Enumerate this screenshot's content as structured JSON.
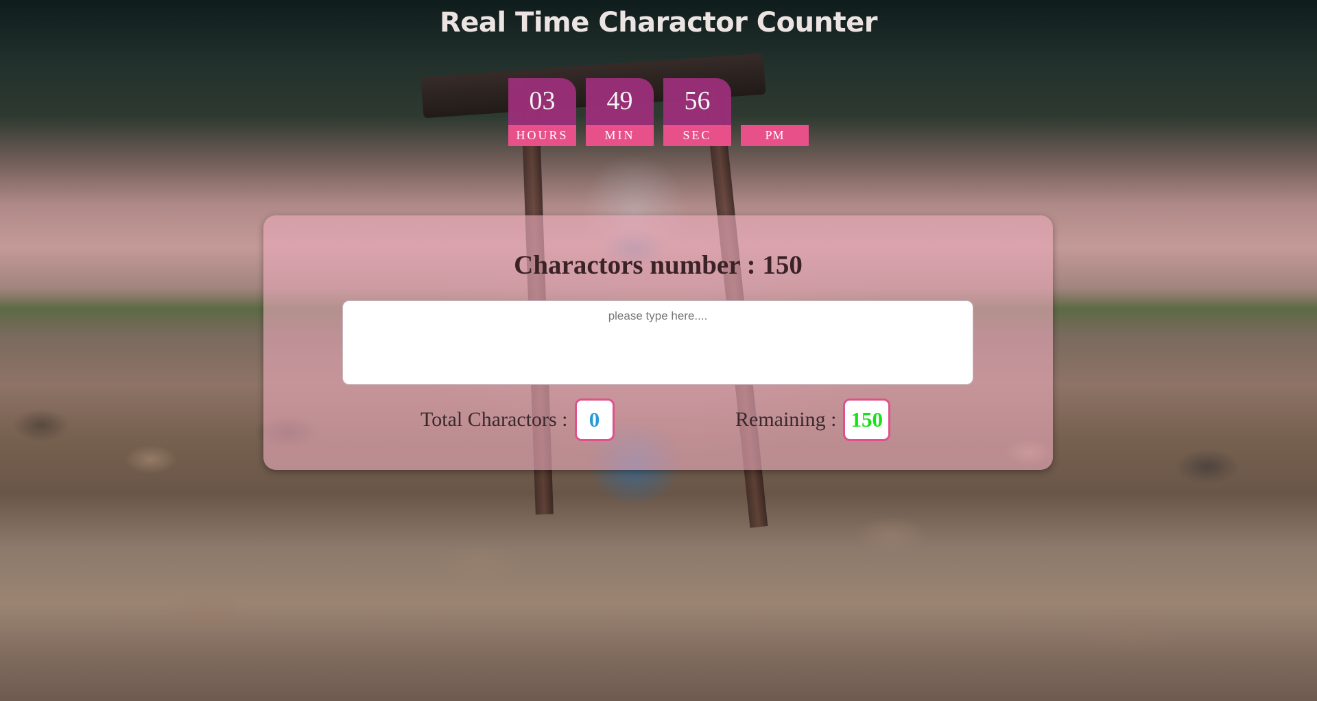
{
  "page": {
    "title": "Real Time Charactor Counter"
  },
  "clock": {
    "hours": "03",
    "hours_label": "HOURS",
    "minutes": "49",
    "minutes_label": "MIN",
    "seconds": "56",
    "seconds_label": "SEC",
    "ampm": "PM"
  },
  "counter": {
    "heading": "Charactors number : 150",
    "input": {
      "value": "",
      "placeholder": "please type here...."
    },
    "total_label": "Total Charactors :",
    "total_value": "0",
    "remaining_label": "Remaining :",
    "remaining_value": "150"
  },
  "colors": {
    "clock_value_bg": "#9c2f7a",
    "clock_label_bg": "#e8508a",
    "total_value_color": "#2a9ad6",
    "remaining_value_color": "#16e016",
    "box_border": "#e0508a"
  }
}
